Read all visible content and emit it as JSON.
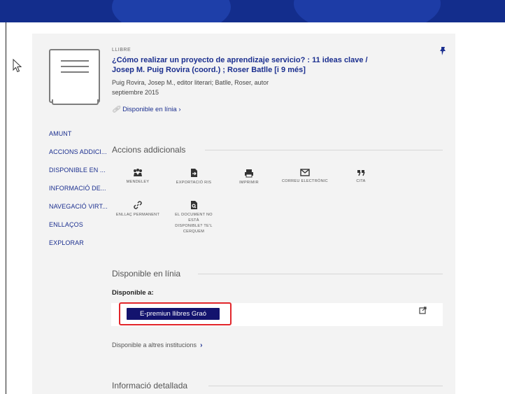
{
  "record": {
    "type": "LLIBRE",
    "title_line1": "¿Cómo realizar un proyecto de aprendizaje servicio? : 11 ideas clave /",
    "title_line2": "Josep M. Puig Rovira (coord.) ; Roser Batlle [i 9 més]",
    "authors": "Puig Rovira, Josep M., editor literari; Batlle, Roser, autor",
    "date": "septiembre 2015",
    "availability": "Disponible en línia",
    "availability_chevron": "›"
  },
  "side_nav": [
    "AMUNT",
    "ACCIONS ADDICI...",
    "DISPONIBLE EN ...",
    "INFORMACIÓ DE...",
    "NAVEGACIÓ VIRT...",
    "ENLLAÇOS",
    "EXPLORAR"
  ],
  "actions_section": {
    "heading": "Accions addicionals",
    "actions": [
      {
        "label": "MENDELEY",
        "icon": "mendeley-icon"
      },
      {
        "label": "EXPORTACIÓ RIS",
        "icon": "export-ris-icon"
      },
      {
        "label": "IMPRIMIR",
        "icon": "print-icon"
      },
      {
        "label": "CORREU ELECTRÒNIC",
        "icon": "email-icon"
      },
      {
        "label": "CITA",
        "icon": "quote-icon"
      },
      {
        "label": "ENLLAÇ PERMANENT",
        "icon": "link-icon"
      },
      {
        "label": "EL DOCUMENT NO ESTÀ DISPONIBLE? TE'L CERQUEM",
        "icon": "document-search-icon"
      }
    ]
  },
  "online_section": {
    "heading": "Disponible en línia",
    "available_at_label": "Disponible a:",
    "provider_button": "E-premiun llibres Graó",
    "other_institutions": "Disponible a altres institucions",
    "other_chevron": "›"
  },
  "details_section": {
    "heading": "Informació detallada"
  },
  "colors": {
    "top_bar": "#132d8c",
    "link": "#1b2f8f",
    "provider_button_bg": "#13136e",
    "highlight_border": "#e2262b",
    "card_bg": "#f3f3f3"
  }
}
